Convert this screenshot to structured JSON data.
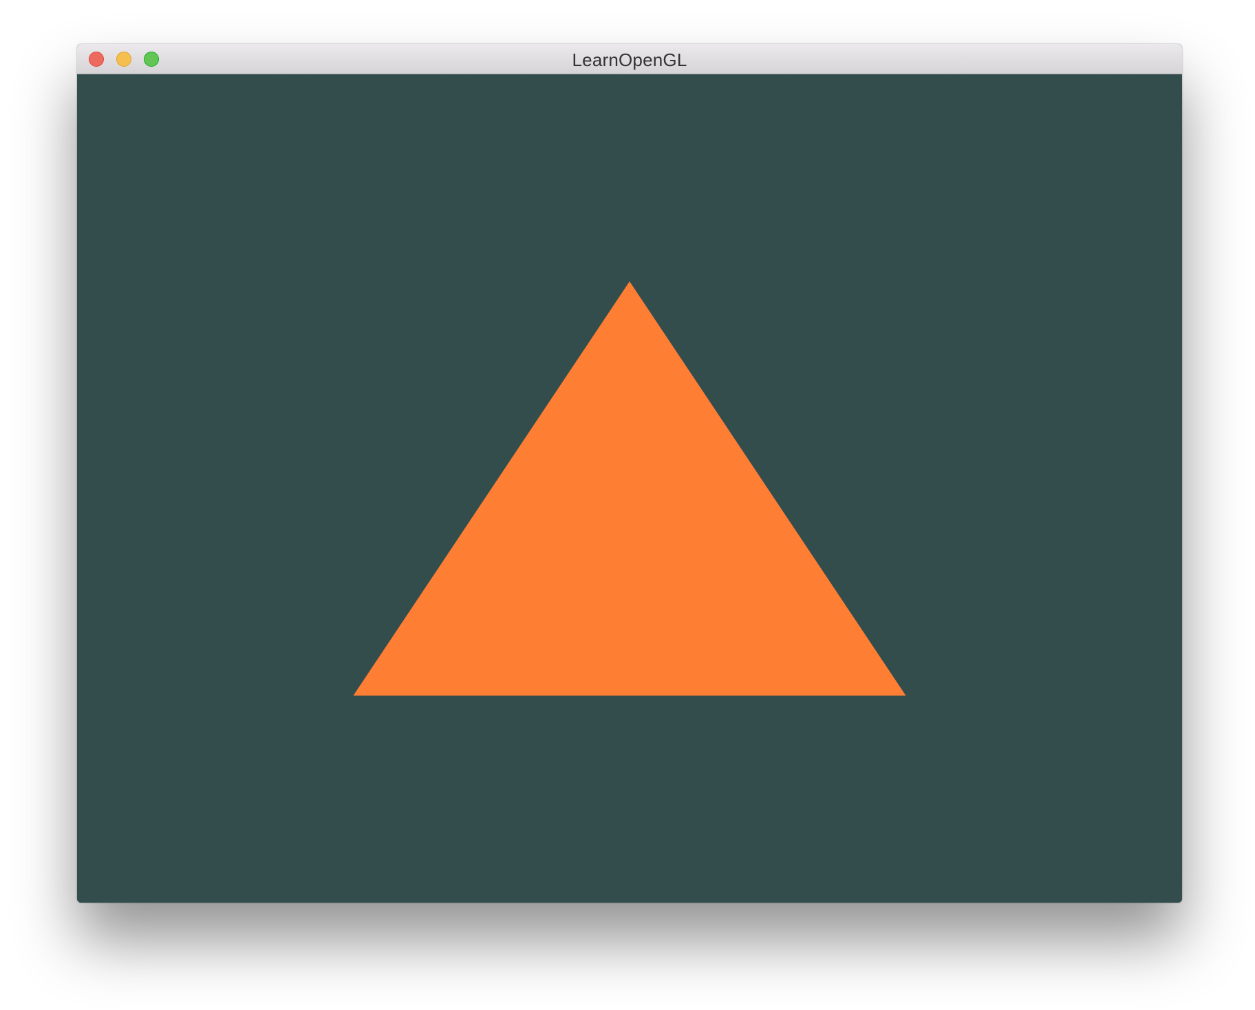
{
  "window": {
    "title": "LearnOpenGL",
    "controls": {
      "close_color": "#ed6a5e",
      "minimize_color": "#f5bf4f",
      "zoom_color": "#62c554"
    }
  },
  "viewport": {
    "clear_color": "#334d4d",
    "triangle": {
      "color": "#fe7f33",
      "vertices_ndc": [
        [
          -0.5,
          -0.5
        ],
        [
          0.5,
          -0.5
        ],
        [
          0.0,
          0.5
        ]
      ]
    }
  }
}
